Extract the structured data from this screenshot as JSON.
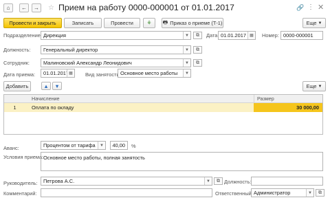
{
  "window": {
    "title": "Прием на работу 0000-000001 от 01.01.2017"
  },
  "nav": {
    "home_icon": "home-icon",
    "back_icon": "arrow-left-icon",
    "forward_icon": "arrow-right-icon",
    "star_icon": "star-icon",
    "link_icon": "link-icon",
    "more_icon": "more-vertical-icon",
    "close_icon": "close-icon"
  },
  "toolbar": {
    "post_close": "Провести и закрыть",
    "save": "Записать",
    "post": "Провести",
    "print_order": "Приказ о приеме (Т-1)",
    "more": "Еще"
  },
  "form": {
    "department_label": "Подразделение:",
    "department": "Дирекция",
    "date_label": "Дата:",
    "date": "01.01.2017",
    "number_label": "Номер:",
    "number": "0000-000001",
    "position_label": "Должность:",
    "position": "Генеральный директор",
    "employee_label": "Сотрудник:",
    "employee": "Малиновский Александр Леонидович",
    "hire_date_label": "Дата приема:",
    "hire_date": "01.01.2017",
    "employment_type_label": "Вид занятости:",
    "employment_type": "Основное место работы"
  },
  "accruals": {
    "add": "Добавить",
    "more": "Еще",
    "columns": [
      "Начисление",
      "Размер"
    ],
    "rows": [
      {
        "num": "1",
        "name": "Оплата по окладу",
        "amount": "30 000,00"
      }
    ]
  },
  "bottom": {
    "advance_label": "Аванс:",
    "advance_type": "Процентом от тарифа",
    "advance_value": "40,00",
    "advance_unit": "%",
    "conditions_label": "Условия приема:",
    "conditions": "Основное место работы, полная занятость",
    "manager_label": "Руководитель:",
    "manager": "Петрова А.С.",
    "manager_position_label": "Должность:",
    "manager_position": "",
    "comment_label": "Комментарий:",
    "comment": "",
    "responsible_label": "Ответственный:",
    "responsible": "Администратор"
  }
}
